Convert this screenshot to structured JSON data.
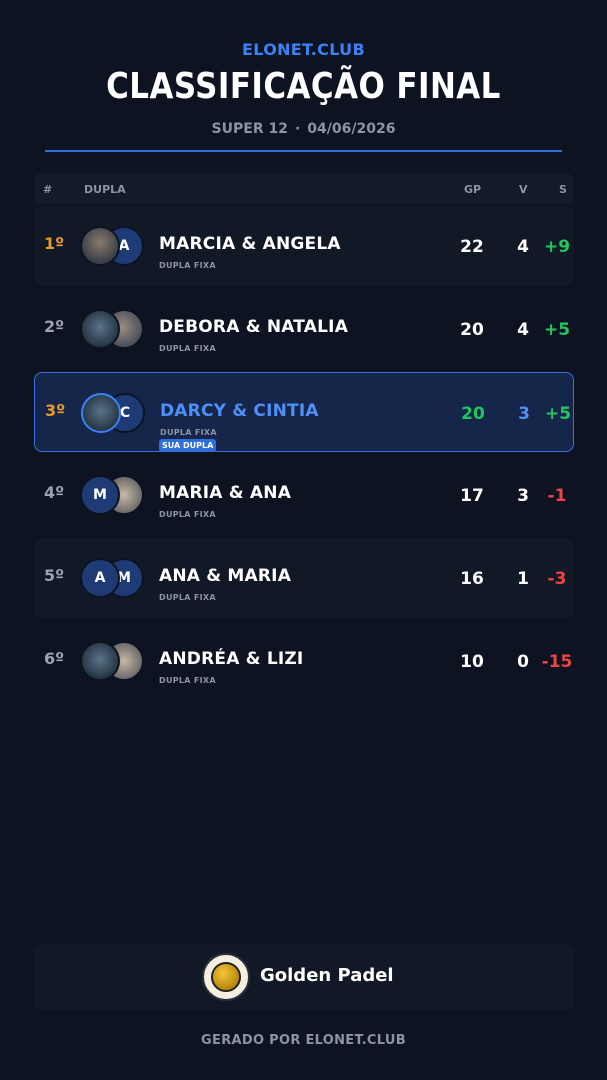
{
  "header": {
    "brand": "ELONET.CLUB",
    "title": "CLASSIFICAÇÃO FINAL",
    "event": "SUPER 12",
    "separator": "·",
    "date": "04/06/2026"
  },
  "table": {
    "headers": {
      "pos": "#",
      "pair": "DUPLA",
      "gp": "GP",
      "v": "V",
      "s": "S"
    },
    "rows": [
      {
        "pos": "1º",
        "name": "MARCIA & ANGELA",
        "tag": "DUPLA FIXA",
        "gp": "22",
        "v": "4",
        "s": "+9",
        "avatar1": "",
        "avatar2": "A"
      },
      {
        "pos": "2º",
        "name": "DEBORA & NATALIA",
        "tag": "DUPLA FIXA",
        "gp": "20",
        "v": "4",
        "s": "+5",
        "avatar1": "",
        "avatar2": ""
      },
      {
        "pos": "3º",
        "name": "DARCY & CINTIA",
        "tag": "DUPLA FIXA",
        "badge": "SUA DUPLA",
        "gp": "20",
        "v": "3",
        "s": "+5",
        "avatar1": "",
        "avatar2": "C"
      },
      {
        "pos": "4º",
        "name": "MARIA & ANA",
        "tag": "DUPLA FIXA",
        "gp": "17",
        "v": "3",
        "s": "-1",
        "avatar1": "M",
        "avatar2": ""
      },
      {
        "pos": "5º",
        "name": "ANA & MARIA",
        "tag": "DUPLA FIXA",
        "gp": "16",
        "v": "1",
        "s": "-3",
        "avatar1": "A",
        "avatar2": "M"
      },
      {
        "pos": "6º",
        "name": "ANDRÉA & LIZI",
        "tag": "DUPLA FIXA",
        "gp": "10",
        "v": "0",
        "s": "-15",
        "avatar1": "",
        "avatar2": ""
      }
    ]
  },
  "footer": {
    "club_name": "Golden Padel",
    "generated": "GERADO POR ELONET.CLUB"
  },
  "colors": {
    "accent": "#3b82f6",
    "positive": "#22c55e",
    "negative": "#ef4444",
    "gold": "#e89a2c"
  }
}
